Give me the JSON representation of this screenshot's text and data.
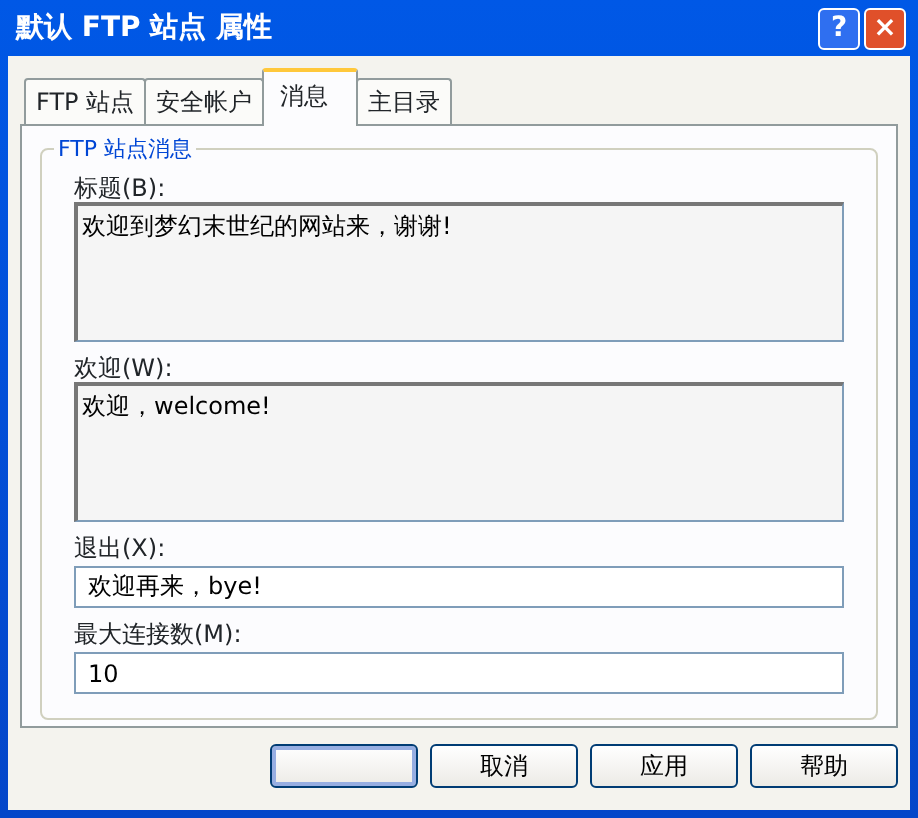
{
  "window": {
    "title": "默认 FTP 站点 属性",
    "help_button": "?",
    "close_button": "×"
  },
  "tabs": [
    {
      "label": "FTP 站点",
      "selected": false
    },
    {
      "label": "安全帐户",
      "selected": false
    },
    {
      "label": "消息",
      "selected": true
    },
    {
      "label": "主目录",
      "selected": false
    }
  ],
  "group": {
    "title": "FTP 站点消息",
    "fields": [
      {
        "kind": "multiline",
        "label": "标题(B):",
        "value": "欢迎到梦幻末世纪的网站来，谢谢!"
      },
      {
        "kind": "multiline",
        "label": "欢迎(W):",
        "value": "欢迎，welcome!"
      },
      {
        "kind": "line",
        "label": "退出(X):",
        "value": "欢迎再来，bye!"
      },
      {
        "kind": "line",
        "label": "最大连接数(M):",
        "value": "10"
      }
    ]
  },
  "buttons": [
    {
      "default": true
    },
    {
      "label": "取消",
      "default": false
    },
    {
      "label": "应用",
      "default": false
    },
    {
      "label": "帮助",
      "default": false
    }
  ]
}
